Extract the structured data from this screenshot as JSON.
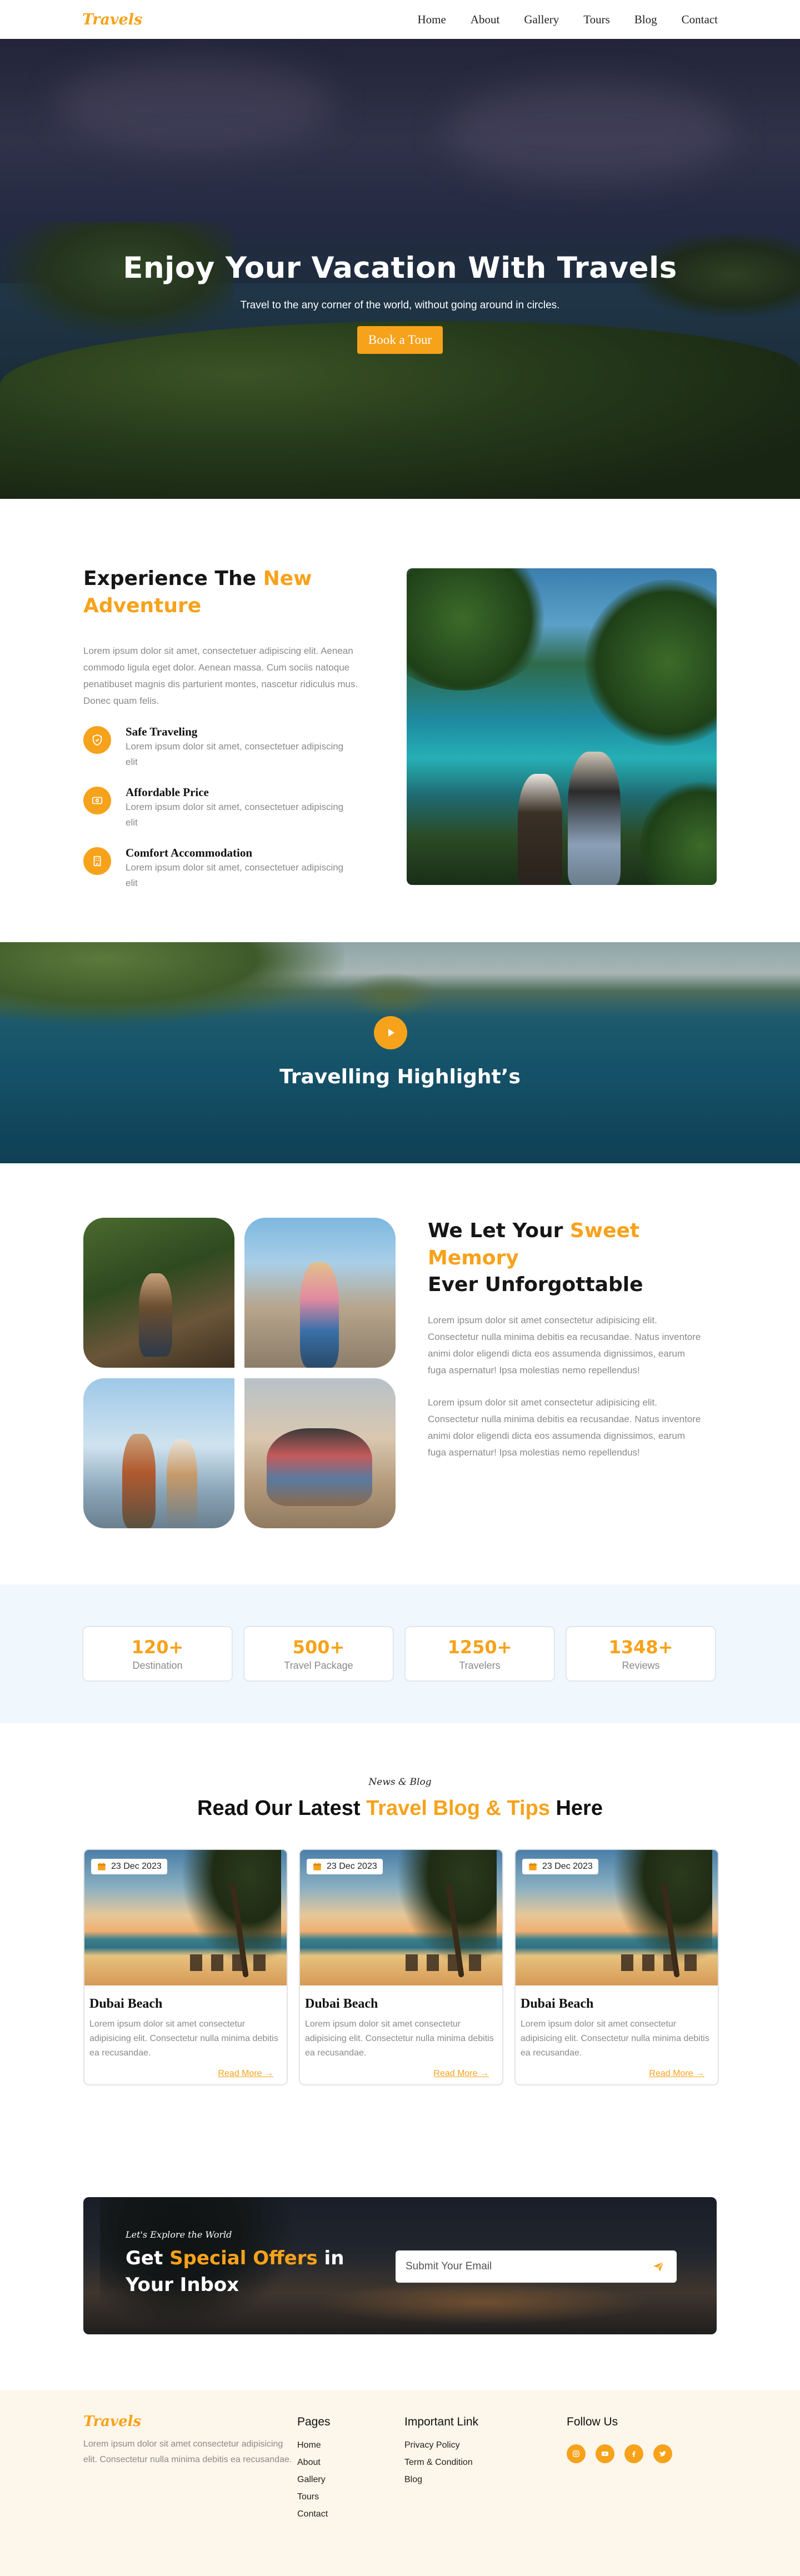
{
  "brand": {
    "logo": "Travels",
    "accent": "#f7a21b"
  },
  "nav": {
    "items": [
      "Home",
      "About",
      "Gallery",
      "Tours",
      "Blog",
      "Contact"
    ]
  },
  "hero": {
    "title": "Enjoy Your Vacation With Travels",
    "subtitle": "Travel to the any corner of the world, without going around in circles.",
    "button": "Book a Tour"
  },
  "experience": {
    "title_part1": "Experience The ",
    "title_highlight": "New Adventure",
    "paragraph": "Lorem ipsum dolor sit amet, consectetuer adipiscing elit. Aenean commodo ligula eget dolor. Aenean massa. Cum sociis natoque penatibuset magnis dis parturient montes, nascetur ridiculus mus. Donec quam felis.",
    "features": [
      {
        "icon": "shield-icon",
        "title": "Safe Traveling",
        "desc": "Lorem ipsum dolor sit amet, consectetuer adipiscing elit"
      },
      {
        "icon": "money-icon",
        "title": "Affordable Price",
        "desc": "Lorem ipsum dolor sit amet, consectetuer adipiscing elit"
      },
      {
        "icon": "hotel-icon",
        "title": "Comfort Accommodation",
        "desc": "Lorem ipsum dolor sit amet, consectetuer adipiscing elit"
      }
    ]
  },
  "video": {
    "title": "Travelling Highlight’s"
  },
  "memory": {
    "title_part1": "We Let Your ",
    "title_highlight": "Sweet Memory",
    "title_part2": "Ever Unforgottable",
    "paragraphs": [
      "Lorem ipsum dolor sit amet consectetur adipisicing elit.  Consectetur nulla minima debitis ea recusandae. Natus  inventore animi dolor eligendi dicta eos assumenda  dignissimos, earum fuga aspernatur! Ipsa molestias nemo repellendus!",
      "Lorem ipsum dolor sit amet consectetur adipisicing elit.  Consectetur nulla minima debitis ea recusandae. Natus  inventore animi dolor eligendi dicta eos assumenda  dignissimos, earum fuga aspernatur! Ipsa molestias nemo repellendus!"
    ]
  },
  "stats": [
    {
      "value": "120+",
      "label": "Destination"
    },
    {
      "value": "500+",
      "label": "Travel Package"
    },
    {
      "value": "1250+",
      "label": "Travelers"
    },
    {
      "value": "1348+",
      "label": "Reviews"
    }
  ],
  "blog": {
    "kicker": "News & Blog",
    "title_part1": "Read Our Latest ",
    "title_highlight": "Travel Blog & Tips",
    "title_part2": " Here",
    "cards": [
      {
        "date": "23 Dec 2023",
        "title": "Dubai Beach",
        "desc": "Lorem ipsum dolor sit amet consectetur adipisicing  elit.  Consectetur nulla minima debitis ea recusandae.",
        "link": "Read More"
      },
      {
        "date": "23 Dec 2023",
        "title": "Dubai Beach",
        "desc": "Lorem ipsum dolor sit amet consectetur adipisicing  elit.  Consectetur nulla minima debitis ea recusandae.",
        "link": "Read More"
      },
      {
        "date": "23 Dec 2023",
        "title": "Dubai Beach",
        "desc": "Lorem ipsum dolor sit amet consectetur adipisicing  elit.  Consectetur nulla minima debitis ea recusandae.",
        "link": "Read More"
      }
    ]
  },
  "newsletter": {
    "kicker": "Let's Explore the World",
    "title_part1": "Get ",
    "title_highlight": "Special Offers",
    "title_part2": " in Your Inbox",
    "placeholder": "Submit Your Email"
  },
  "footer": {
    "logo": "Travels",
    "desc": "Lorem ipsum dolor sit amet consectetur adipisicing  elit.  Consectetur nulla minima debitis ea recusandae.",
    "pages_title": "Pages",
    "pages": [
      "Home",
      "About",
      "Gallery",
      "Tours",
      "Contact"
    ],
    "links_title": "Important Link",
    "links": [
      "Privacy Policy",
      "Term & Condition",
      "Blog"
    ],
    "follow_title": "Follow Us",
    "social": [
      "instagram-icon",
      "youtube-icon",
      "facebook-icon",
      "twitter-icon"
    ]
  }
}
